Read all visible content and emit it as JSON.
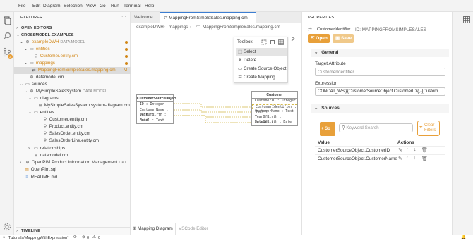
{
  "menu": [
    "File",
    "Edit",
    "Diagram",
    "Selection",
    "View",
    "Go",
    "Run",
    "Terminal",
    "Help"
  ],
  "explorer": {
    "title": "EXPLORER",
    "more": "···",
    "open_editors": "OPEN EDITORS",
    "workspace": "CROSSMODEL-EXAMPLES",
    "timeline": "TIMELINE",
    "tree": {
      "exampleDWH": "exampleDWH",
      "exampleDWH_tag": "DATA MODEL",
      "entities": "entities",
      "customer_entity": "Customer.entity.cm",
      "mappings": "mappings",
      "mapping_file": "MappingFromSimpleSales.mapping.cm",
      "mapping_badge": "M",
      "datamodel": "datamodel.cm",
      "sources": "sources",
      "mysimple": "MySimpleSalesSystem",
      "mysimple_tag": "DATA MODEL",
      "diagrams": "diagrams",
      "system_diagram": "MySimpleSalesSystem.system-diagram.cm",
      "entities2": "entities",
      "e_customer": "Customer.entity.cm",
      "e_product": "Product.entity.cm",
      "e_salesorder": "SalesOrder.entity.cm",
      "e_salesorderline": "SalesOrderLine.entity.cm",
      "relationships": "relationships",
      "datamodel2": "datamodel.cm",
      "openpim": "OpenPIM Product Information Management",
      "openpim_tag": "DAT...",
      "openpim_sql": "OpenPim.sql",
      "readme": "README.md"
    }
  },
  "editor": {
    "tab_welcome": "Welcome",
    "tab_mapping": "MappingFromSimpleSales.mapping.cm",
    "tab_mapping_badge": "M",
    "breadcrumb": [
      "exampleDWH",
      "mappings",
      "MappingFromSimpleSales.mapping.cm"
    ],
    "bottom_tab_diagram": "Mapping Diagram",
    "bottom_tab_editor": "VSCode Editor"
  },
  "toolbox": {
    "title": "Toolbox",
    "items": [
      "Select",
      "Delete",
      "Create Source Object",
      "Create Mapping"
    ]
  },
  "diagram": {
    "source": {
      "title": "CustomerSourceObject",
      "attrs": [
        "ID : Integer",
        "CustomerName : Text",
        "DateOfBirth : Date",
        "Email : Text"
      ]
    },
    "target": {
      "title": "Customer",
      "attrs": [
        "CustomerID : Integer",
        "CustomerIdentifier : Text (",
        "CustomerName : Text",
        "YearOfBirth : Integer (",
        "DateOfBirth : Date"
      ]
    }
  },
  "properties": {
    "title": "PROPERTIES",
    "element_name": "CustomerIdentifier",
    "element_id": "ID: MAPPINGFROMSIMPLESALES",
    "open_btn": "Open",
    "save_btn": "Save",
    "general_header": "General",
    "target_attr_label": "Target Attribute",
    "target_attr_value": "CustomerIdentifier",
    "expression_label": "Expression",
    "expression_value": "CONCAT_WS({{CustomerSourceObject.CustomerID}},{{Custom",
    "sources_header": "Sources",
    "add_src_btn": "+ So",
    "keyword_placeholder": "Keyword Search",
    "clear_filters": "Clear Filters",
    "col_value": "Value",
    "col_actions": "Actions",
    "rows": [
      "CustomerSourceObject.CustomerID",
      "CustomerSourceObject.CustomerName"
    ]
  },
  "status": {
    "branch": "Tutorials/MappingWithExpression*",
    "errors": "0",
    "warnings": "0"
  },
  "colors": {
    "accent_orange": "#e8a03a",
    "save_disabled": "#f0c98a",
    "link_blue": "#3d7ed1",
    "modified_orange": "#d18616"
  }
}
